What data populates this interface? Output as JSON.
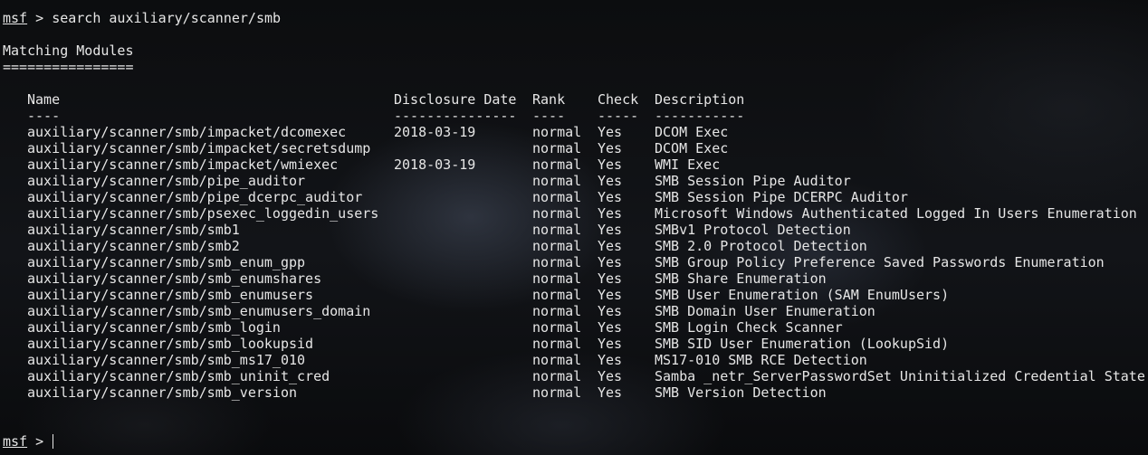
{
  "prompt": "msf",
  "prompt_sep": " > ",
  "command": "search auxiliary/scanner/smb",
  "section_title": "Matching Modules",
  "section_rule": "================",
  "headers": {
    "name": "Name",
    "date": "Disclosure Date",
    "rank": "Rank",
    "check": "Check",
    "desc": "Description"
  },
  "dashes": {
    "name": "----",
    "date": "---------------",
    "rank": "----",
    "check": "-----",
    "desc": "-----------"
  },
  "rows": [
    {
      "name": "auxiliary/scanner/smb/impacket/dcomexec",
      "date": "2018-03-19",
      "rank": "normal",
      "check": "Yes",
      "desc": "DCOM Exec"
    },
    {
      "name": "auxiliary/scanner/smb/impacket/secretsdump",
      "date": "",
      "rank": "normal",
      "check": "Yes",
      "desc": "DCOM Exec"
    },
    {
      "name": "auxiliary/scanner/smb/impacket/wmiexec",
      "date": "2018-03-19",
      "rank": "normal",
      "check": "Yes",
      "desc": "WMI Exec"
    },
    {
      "name": "auxiliary/scanner/smb/pipe_auditor",
      "date": "",
      "rank": "normal",
      "check": "Yes",
      "desc": "SMB Session Pipe Auditor"
    },
    {
      "name": "auxiliary/scanner/smb/pipe_dcerpc_auditor",
      "date": "",
      "rank": "normal",
      "check": "Yes",
      "desc": "SMB Session Pipe DCERPC Auditor"
    },
    {
      "name": "auxiliary/scanner/smb/psexec_loggedin_users",
      "date": "",
      "rank": "normal",
      "check": "Yes",
      "desc": "Microsoft Windows Authenticated Logged In Users Enumeration"
    },
    {
      "name": "auxiliary/scanner/smb/smb1",
      "date": "",
      "rank": "normal",
      "check": "Yes",
      "desc": "SMBv1 Protocol Detection"
    },
    {
      "name": "auxiliary/scanner/smb/smb2",
      "date": "",
      "rank": "normal",
      "check": "Yes",
      "desc": "SMB 2.0 Protocol Detection"
    },
    {
      "name": "auxiliary/scanner/smb/smb_enum_gpp",
      "date": "",
      "rank": "normal",
      "check": "Yes",
      "desc": "SMB Group Policy Preference Saved Passwords Enumeration"
    },
    {
      "name": "auxiliary/scanner/smb/smb_enumshares",
      "date": "",
      "rank": "normal",
      "check": "Yes",
      "desc": "SMB Share Enumeration"
    },
    {
      "name": "auxiliary/scanner/smb/smb_enumusers",
      "date": "",
      "rank": "normal",
      "check": "Yes",
      "desc": "SMB User Enumeration (SAM EnumUsers)"
    },
    {
      "name": "auxiliary/scanner/smb/smb_enumusers_domain",
      "date": "",
      "rank": "normal",
      "check": "Yes",
      "desc": "SMB Domain User Enumeration"
    },
    {
      "name": "auxiliary/scanner/smb/smb_login",
      "date": "",
      "rank": "normal",
      "check": "Yes",
      "desc": "SMB Login Check Scanner"
    },
    {
      "name": "auxiliary/scanner/smb/smb_lookupsid",
      "date": "",
      "rank": "normal",
      "check": "Yes",
      "desc": "SMB SID User Enumeration (LookupSid)"
    },
    {
      "name": "auxiliary/scanner/smb/smb_ms17_010",
      "date": "",
      "rank": "normal",
      "check": "Yes",
      "desc": "MS17-010 SMB RCE Detection"
    },
    {
      "name": "auxiliary/scanner/smb/smb_uninit_cred",
      "date": "",
      "rank": "normal",
      "check": "Yes",
      "desc": "Samba _netr_ServerPasswordSet Uninitialized Credential State"
    },
    {
      "name": "auxiliary/scanner/smb/smb_version",
      "date": "",
      "rank": "normal",
      "check": "Yes",
      "desc": "SMB Version Detection"
    }
  ],
  "colors": {
    "text": "#e6e6e6",
    "background": "#0a0b0c"
  }
}
